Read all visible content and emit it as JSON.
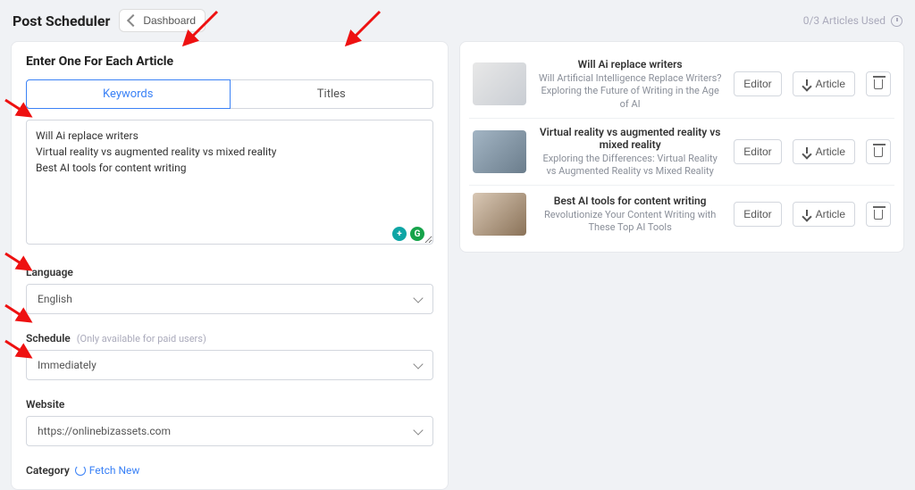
{
  "header": {
    "title": "Post Scheduler",
    "dashboard_label": "Dashboard",
    "usage_text": "0/3 Articles Used"
  },
  "left_panel": {
    "section_heading": "Enter One For Each Article",
    "tabs": {
      "keywords": "Keywords",
      "titles": "Titles"
    },
    "textarea_value": "Will Ai replace writers\nVirtual reality vs augmented reality vs mixed reality\nBest AI tools for content writing",
    "language": {
      "label": "Language",
      "value": "English"
    },
    "schedule": {
      "label": "Schedule",
      "hint": "(Only available for paid users)",
      "value": "Immediately"
    },
    "website": {
      "label": "Website",
      "value": "https://onlinebizassets.com"
    },
    "category": {
      "label": "Category",
      "fetch_label": "Fetch New"
    }
  },
  "articles": [
    {
      "title": "Will Ai replace writers",
      "subtitle": "Will Artificial Intelligence Replace Writers? Exploring the Future of Writing in the Age of AI"
    },
    {
      "title": "Virtual reality vs augmented reality vs mixed reality",
      "subtitle": "Exploring the Differences: Virtual Reality vs Augmented Reality vs Mixed Reality"
    },
    {
      "title": "Best AI tools for content writing",
      "subtitle": "Revolutionize Your Content Writing with These Top AI Tools"
    }
  ],
  "buttons": {
    "editor": "Editor",
    "article": "Article"
  }
}
